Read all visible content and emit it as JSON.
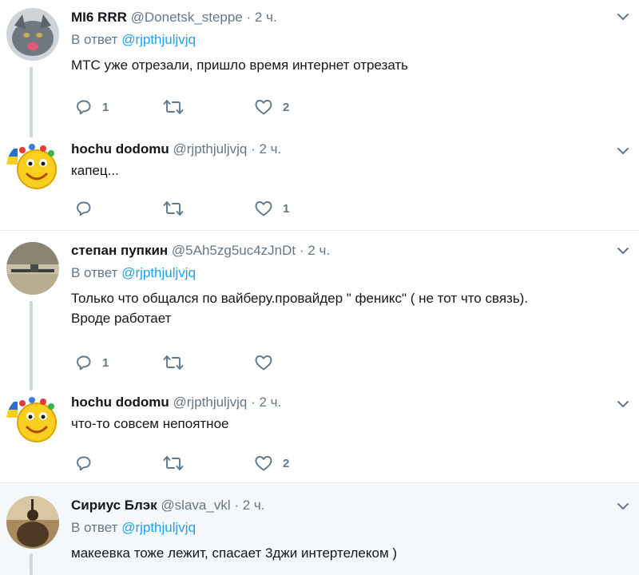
{
  "reply_prefix": "В ответ",
  "tweets": [
    {
      "name": "MI6 RRR",
      "handle": "@Donetsk_steppe",
      "time": "2 ч.",
      "reply_to": "@rjpthjuljvjq",
      "text": "МТС уже отрезали, пришло время интернет отрезать",
      "replies": "1",
      "retweets": "",
      "likes": "2"
    },
    {
      "name": "hochu dodomu",
      "handle": "@rjpthjuljvjq",
      "time": "2 ч.",
      "reply_to": "",
      "text": "капец...",
      "replies": "",
      "retweets": "",
      "likes": "1"
    },
    {
      "name": "степан пупкин",
      "handle": "@5Ah5zg5uc4zJnDt",
      "time": "2 ч.",
      "reply_to": "@rjpthjuljvjq",
      "text": "Только что общался по вайберу.провайдер \" феникс\" ( не тот что связь).\nВроде работает",
      "replies": "1",
      "retweets": "",
      "likes": ""
    },
    {
      "name": "hochu dodomu",
      "handle": "@rjpthjuljvjq",
      "time": "2 ч.",
      "reply_to": "",
      "text": "что-то совсем непоятное",
      "replies": "",
      "retweets": "",
      "likes": "2"
    },
    {
      "name": "Сириус Блэк",
      "handle": "@slava_vkl",
      "time": "2 ч.",
      "reply_to": "@rjpthjuljvjq",
      "text": "макеевка тоже лежит, спасает 3джи интертелеком )",
      "replies": "",
      "retweets": "",
      "likes": ""
    }
  ],
  "colors": {
    "accent": "#1da1f2",
    "muted": "#657786",
    "text": "#14171a",
    "separator": "#e6ecf0",
    "thread_line": "#ccd6dd",
    "highlight_bg": "#f5f8fa"
  },
  "icons": [
    "reply-icon",
    "retweet-icon",
    "like-icon",
    "chevron-down-icon",
    "avatar-image"
  ]
}
